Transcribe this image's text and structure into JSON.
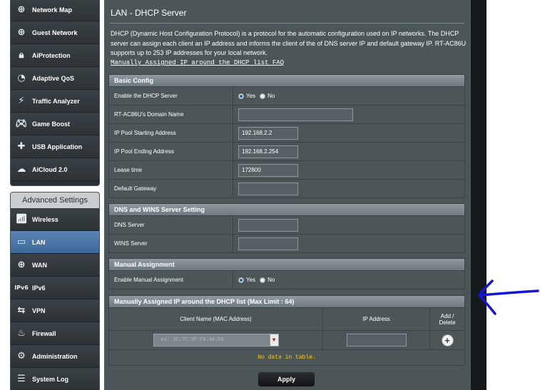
{
  "sidebar": {
    "top_items": [
      {
        "label": "Network Map",
        "icon": "globe"
      },
      {
        "label": "Guest Network",
        "icon": "globe"
      },
      {
        "label": "AiProtection",
        "icon": "lock"
      },
      {
        "label": "Adaptive QoS",
        "icon": "speedometer"
      },
      {
        "label": "Traffic Analyzer",
        "icon": "pulse"
      },
      {
        "label": "Game Boost",
        "icon": "gamepad"
      },
      {
        "label": "USB Application",
        "icon": "puzzle"
      },
      {
        "label": "AiCloud 2.0",
        "icon": "cloud"
      }
    ],
    "advanced_title": "Advanced Settings",
    "advanced_items": [
      {
        "label": "Wireless",
        "icon": "wifi"
      },
      {
        "label": "LAN",
        "icon": "monitor",
        "active": true
      },
      {
        "label": "WAN",
        "icon": "globe"
      },
      {
        "label": "IPv6",
        "icon": "ipv6"
      },
      {
        "label": "VPN",
        "icon": "vpn"
      },
      {
        "label": "Firewall",
        "icon": "fire"
      },
      {
        "label": "Administration",
        "icon": "gear"
      },
      {
        "label": "System Log",
        "icon": "log"
      }
    ]
  },
  "page": {
    "title": "LAN - DHCP Server",
    "description": "DHCP (Dynamic Host Configuration Protocol) is a protocol for the automatic configuration used on IP networks. The DHCP server can assign each client an IP address and informs the client of the of DNS server IP and default gateway IP. RT-AC86U supports up to 253 IP addresses for your local network.",
    "faq_link": "Manually Assigned IP around the DHCP list FAQ"
  },
  "basic_config": {
    "title": "Basic Config",
    "enable_label": "Enable the DHCP Server",
    "yes": "Yes",
    "no": "No",
    "domain_label": "RT-AC86U's Domain Name",
    "domain_value": "",
    "start_label": "IP Pool Starting Address",
    "start_value": "192.168.2.2",
    "end_label": "IP Pool Ending Address",
    "end_value": "192.168.2.254",
    "lease_label": "Lease time",
    "lease_value": "172800",
    "gateway_label": "Default Gateway",
    "gateway_value": ""
  },
  "dns_wins": {
    "title": "DNS and WINS Server Setting",
    "dns_label": "DNS Server",
    "dns_value": "",
    "wins_label": "WINS Server",
    "wins_value": ""
  },
  "manual": {
    "title": "Manual Assignment",
    "enable_label": "Enable Manual Assignment",
    "yes": "Yes",
    "no": "No"
  },
  "dhcp_list": {
    "title": "Manually Assigned IP around the DHCP list (Max Limit : 64)",
    "col_client": "Client Name (MAC Address)",
    "col_ip": "IP Address",
    "col_add_1": "Add /",
    "col_add_2": "Delete",
    "mac_placeholder": "ex: 3C:7C:3F:F9:40:E8",
    "no_data": "No data in table."
  },
  "apply_label": "Apply",
  "colors": {
    "panel": "#4c5659",
    "section_header": "#7f8a90",
    "active_menu": "#4a76a6",
    "annotation_arrow": "#1515d8",
    "no_data_text": "#ffcc00"
  }
}
